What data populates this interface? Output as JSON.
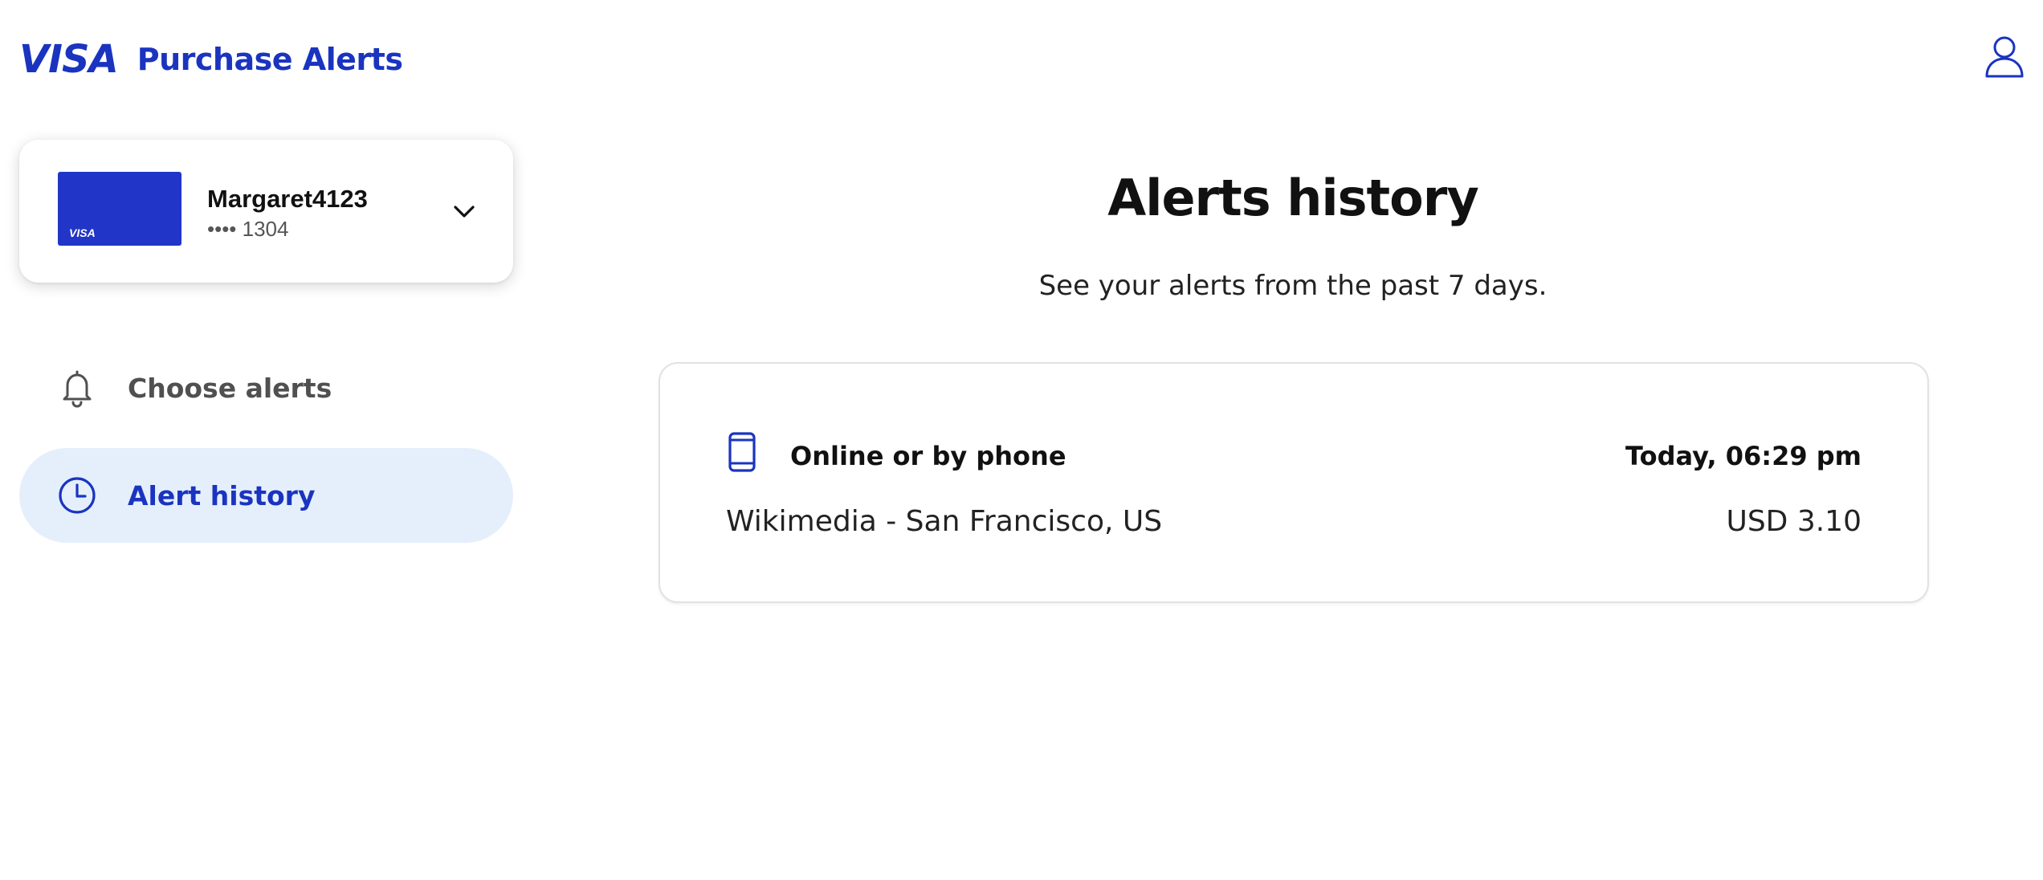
{
  "header": {
    "logo_text": "VISA",
    "product_title": "Purchase Alerts",
    "profile_icon": "user-icon"
  },
  "account": {
    "name": "Margaret4123",
    "masked_number": "•••• 1304",
    "card_brand": "VISA",
    "card_color": "#2135c8"
  },
  "sidebar": {
    "items": [
      {
        "label": "Choose alerts",
        "icon": "bell-icon",
        "active": false
      },
      {
        "label": "Alert history",
        "icon": "clock-icon",
        "active": true
      }
    ]
  },
  "main": {
    "title": "Alerts history",
    "subtitle": "See your alerts from the past 7 days.",
    "alerts": [
      {
        "channel": "Online or by phone",
        "channel_icon": "mobile-phone-icon",
        "timestamp": "Today, 06:29 pm",
        "merchant": "Wikimedia - San Francisco, US",
        "amount": "USD 3.10"
      }
    ]
  },
  "colors": {
    "brand_blue": "#1a34c0",
    "active_nav_bg": "#e5effc",
    "muted_text": "#505050"
  }
}
